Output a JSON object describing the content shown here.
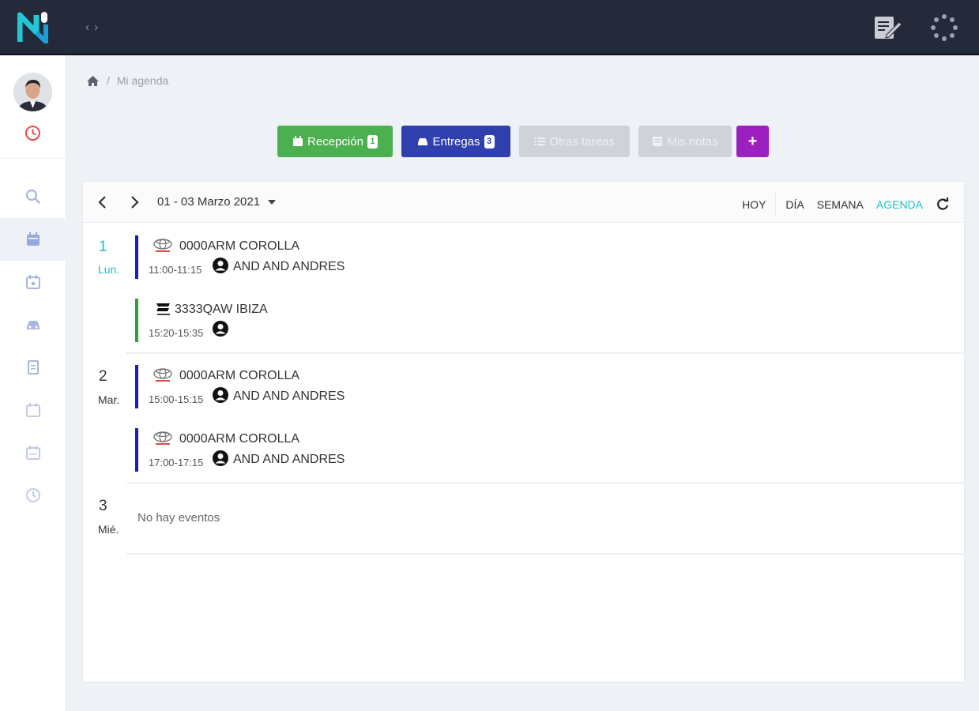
{
  "header": {
    "collapse_label": "‹ ›",
    "logo_icon": "logo-n-icon",
    "notes_icon": "edit-note-icon",
    "loading_icon": "spinner-icon"
  },
  "sidebar": {
    "status_icon": "clock-icon",
    "items": [
      {
        "icon": "search-icon",
        "active": false
      },
      {
        "icon": "calendar-filled-icon",
        "active": true
      },
      {
        "icon": "calendar-check-icon",
        "active": false
      },
      {
        "icon": "car-icon",
        "active": false
      },
      {
        "icon": "document-icon",
        "active": false
      },
      {
        "icon": "calendar-plus-icon",
        "active": false
      },
      {
        "icon": "calendar-grid-icon",
        "active": false
      },
      {
        "icon": "clock-icon",
        "active": false
      }
    ]
  },
  "breadcrumb": {
    "home_icon": "home-icon",
    "separator": "/",
    "current": "Mi agenda"
  },
  "actions": {
    "reception": {
      "label": "Recepción",
      "badge": "1",
      "color": "#4caf50"
    },
    "deliveries": {
      "label": "Entregas",
      "badge": "3",
      "color": "#2f3fad"
    },
    "other_tasks": {
      "label": "Otras tareas"
    },
    "my_notes": {
      "label": "Mis notas"
    },
    "add": {
      "label": "+",
      "color": "#9c1fbf"
    }
  },
  "calendar": {
    "range": "01 - 03 Marzo 2021",
    "views": {
      "today": "HOY",
      "day": "DÍA",
      "week": "SEMANA",
      "agenda": "AGENDA"
    },
    "accent": "#1ec1c6",
    "days": [
      {
        "num": "1",
        "name": "Lun.",
        "events": [
          {
            "vehicle": "0000ARM COROLLA",
            "time": "11:00-11:15",
            "client": "AND AND ANDRES",
            "brand": "toyota-logo-icon",
            "color": "#1a1fb0"
          },
          {
            "vehicle": "3333QAW IBIZA",
            "time": "15:20-15:35",
            "client": "",
            "brand": "seat-logo-icon",
            "color": "#2e9e3a"
          }
        ]
      },
      {
        "num": "2",
        "name": "Mar.",
        "events": [
          {
            "vehicle": "0000ARM COROLLA",
            "time": "15:00-15:15",
            "client": "AND AND ANDRES",
            "brand": "toyota-logo-icon",
            "color": "#1a1fb0"
          },
          {
            "vehicle": "0000ARM COROLLA",
            "time": "17:00-17:15",
            "client": "AND AND ANDRES",
            "brand": "toyota-logo-icon",
            "color": "#1a1fb0"
          }
        ]
      },
      {
        "num": "3",
        "name": "Mié.",
        "no_events": "No hay eventos"
      }
    ]
  }
}
